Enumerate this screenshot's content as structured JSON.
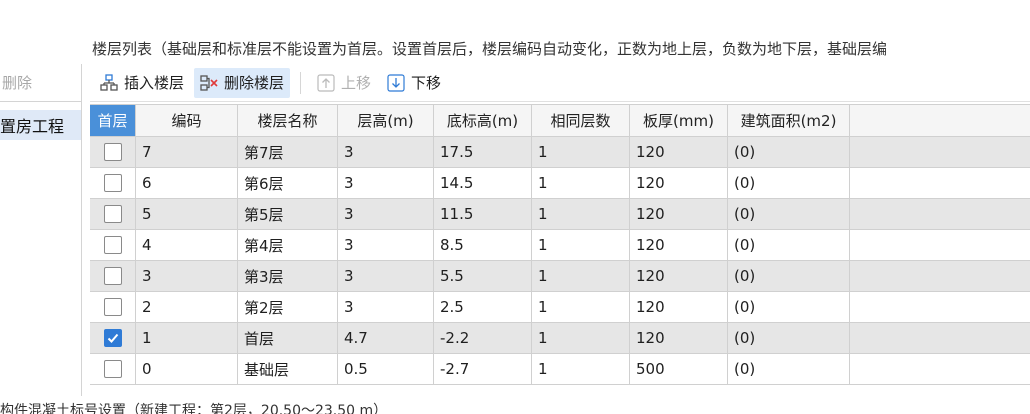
{
  "section_title": "楼层列表（基础层和标准层不能设置为首层。设置首层后，楼层编码自动变化，正数为地上层，负数为地下层，基础层编",
  "left_panel": {
    "delete_label": "删除",
    "selected_item": "置房工程"
  },
  "toolbar": {
    "insert_label": "插入楼层",
    "delete_label": "删除楼层",
    "move_up_label": "上移",
    "move_down_label": "下移"
  },
  "table": {
    "headers": [
      "首层",
      "编码",
      "楼层名称",
      "层高(m)",
      "底标高(m)",
      "相同层数",
      "板厚(mm)",
      "建筑面积(m2)",
      ""
    ],
    "rows": [
      {
        "first": false,
        "code": "7",
        "name": "第7层",
        "height": "3",
        "base": "17.5",
        "same": "1",
        "thick": "120",
        "area": "(0)"
      },
      {
        "first": false,
        "code": "6",
        "name": "第6层",
        "height": "3",
        "base": "14.5",
        "same": "1",
        "thick": "120",
        "area": "(0)"
      },
      {
        "first": false,
        "code": "5",
        "name": "第5层",
        "height": "3",
        "base": "11.5",
        "same": "1",
        "thick": "120",
        "area": "(0)"
      },
      {
        "first": false,
        "code": "4",
        "name": "第4层",
        "height": "3",
        "base": "8.5",
        "same": "1",
        "thick": "120",
        "area": "(0)"
      },
      {
        "first": false,
        "code": "3",
        "name": "第3层",
        "height": "3",
        "base": "5.5",
        "same": "1",
        "thick": "120",
        "area": "(0)"
      },
      {
        "first": false,
        "code": "2",
        "name": "第2层",
        "height": "3",
        "base": "2.5",
        "same": "1",
        "thick": "120",
        "area": "(0)"
      },
      {
        "first": true,
        "code": "1",
        "name": "首层",
        "height": "4.7",
        "base": "-2.2",
        "same": "1",
        "thick": "120",
        "area": "(0)"
      },
      {
        "first": false,
        "code": "0",
        "name": "基础层",
        "height": "0.5",
        "base": "-2.7",
        "same": "1",
        "thick": "500",
        "area": "(0)"
      }
    ]
  },
  "bottom_text": "构件混凝土标号设置（新建工程：第2层，20.50～23.50 m）",
  "colors": {
    "accent": "#2f7bd6",
    "header_first_col": "#4a90d9",
    "selected_bg": "#dfe9f7",
    "alt_row": "#e6e6e6"
  }
}
